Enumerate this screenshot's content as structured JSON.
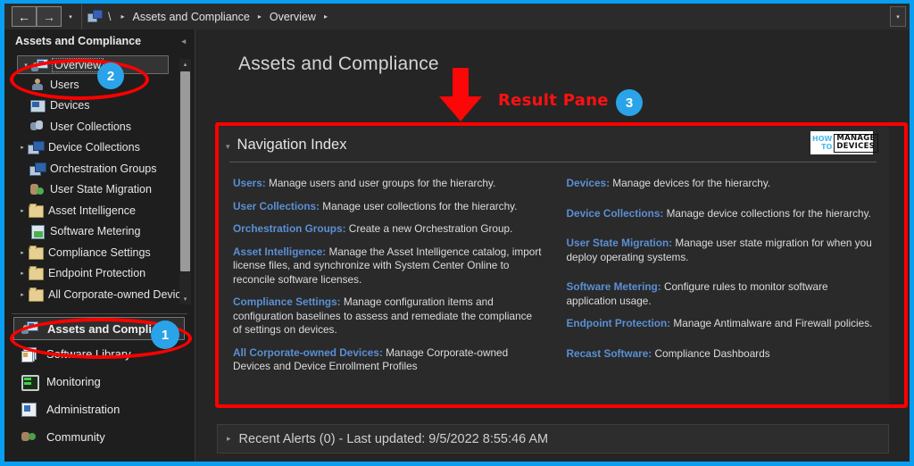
{
  "breadcrumb": {
    "back_label": "←",
    "forward_label": "→",
    "dropdown_label": "▾",
    "root": "\\",
    "items": [
      "Assets and Compliance",
      "Overview"
    ],
    "separator": "▸",
    "icon": "console-node-icon"
  },
  "topbar_right": {
    "label": "▾"
  },
  "sidebar": {
    "title": "Assets and Compliance",
    "collapse_label": "◂",
    "tree": [
      {
        "label": "Overview",
        "icon": "console-node-icon",
        "expander": "▾",
        "indent": 0,
        "selected": true
      },
      {
        "label": "Users",
        "icon": "user-icon",
        "expander": "",
        "indent": 1,
        "selected": false
      },
      {
        "label": "Devices",
        "icon": "monitor-icon",
        "expander": "",
        "indent": 1,
        "selected": false
      },
      {
        "label": "User Collections",
        "icon": "user-collection-icon",
        "expander": "",
        "indent": 1,
        "selected": false
      },
      {
        "label": "Device Collections",
        "icon": "device-collection-icon",
        "expander": "▸",
        "indent": 1,
        "selected": false
      },
      {
        "label": "Orchestration Groups",
        "icon": "device-collection-icon",
        "expander": "",
        "indent": 1,
        "selected": false
      },
      {
        "label": "User State Migration",
        "icon": "user-migration-icon",
        "expander": "",
        "indent": 1,
        "selected": false
      },
      {
        "label": "Asset Intelligence",
        "icon": "folder-icon",
        "expander": "▸",
        "indent": 1,
        "selected": false
      },
      {
        "label": "Software Metering",
        "icon": "metering-icon",
        "expander": "",
        "indent": 1,
        "selected": false
      },
      {
        "label": "Compliance Settings",
        "icon": "folder-icon",
        "expander": "▸",
        "indent": 1,
        "selected": false
      },
      {
        "label": "Endpoint Protection",
        "icon": "folder-icon",
        "expander": "▸",
        "indent": 1,
        "selected": false
      },
      {
        "label": "All Corporate-owned Devic",
        "icon": "folder-icon",
        "expander": "▸",
        "indent": 1,
        "selected": false
      }
    ],
    "scroll": {
      "up": "▴",
      "down": "▾"
    },
    "workspaces": [
      {
        "label": "Assets and Compliance",
        "icon": "assets-compliance-icon",
        "active": true
      },
      {
        "label": "Software Library",
        "icon": "software-library-icon",
        "active": false
      },
      {
        "label": "Monitoring",
        "icon": "monitoring-icon",
        "active": false
      },
      {
        "label": "Administration",
        "icon": "administration-icon",
        "active": false
      },
      {
        "label": "Community",
        "icon": "community-icon",
        "active": false
      }
    ]
  },
  "result_pane": {
    "title": "Assets and Compliance",
    "nav_index": {
      "title": "Navigation Index",
      "collapse_label": "▾",
      "logo": {
        "line1": "HOW",
        "line2": "TO",
        "line3": "MANAGE",
        "line4": "DEVICES"
      },
      "left_column": [
        {
          "key": "Users:",
          "text": " Manage users and user groups for the hierarchy."
        },
        {
          "key": "User Collections:",
          "text": " Manage user collections for the hierarchy."
        },
        {
          "key": "Orchestration Groups:",
          "text": " Create a new Orchestration Group."
        },
        {
          "key": "Asset Intelligence:",
          "text": " Manage the Asset Intelligence catalog, import license files, and synchronize with System Center Online to reconcile software licenses."
        },
        {
          "key": "Compliance Settings:",
          "text": " Manage configuration items and configuration baselines to assess and remediate the compliance of settings on devices."
        },
        {
          "key": "All Corporate-owned Devices:",
          "text": " Manage Corporate-owned Devices and Device Enrollment Profiles"
        }
      ],
      "right_column": [
        {
          "key": "Devices:",
          "text": " Manage devices for the hierarchy."
        },
        {
          "key": "Device Collections:",
          "text": " Manage device collections for the hierarchy."
        },
        {
          "key": "User State Migration:",
          "text": " Manage user state migration for when you deploy operating systems."
        },
        {
          "key": "Software Metering:",
          "text": " Configure rules to monitor software application usage."
        },
        {
          "key": "Endpoint Protection:",
          "text": " Manage Antimalware and Firewall policies."
        },
        {
          "key": "Recast Software:",
          "text": " Compliance Dashboards"
        }
      ]
    },
    "recent_alerts": {
      "collapse_label": "▸",
      "text": "Recent Alerts (0) - Last updated: 9/5/2022 8:55:46 AM"
    }
  },
  "annotations": {
    "callout_1": "1",
    "callout_2": "2",
    "callout_3": "3",
    "result_pane_label": "Result Pane",
    "highlight_color": "#ff0000",
    "badge_color": "#2aa3e8",
    "window_border_color": "#0a9ef0"
  }
}
